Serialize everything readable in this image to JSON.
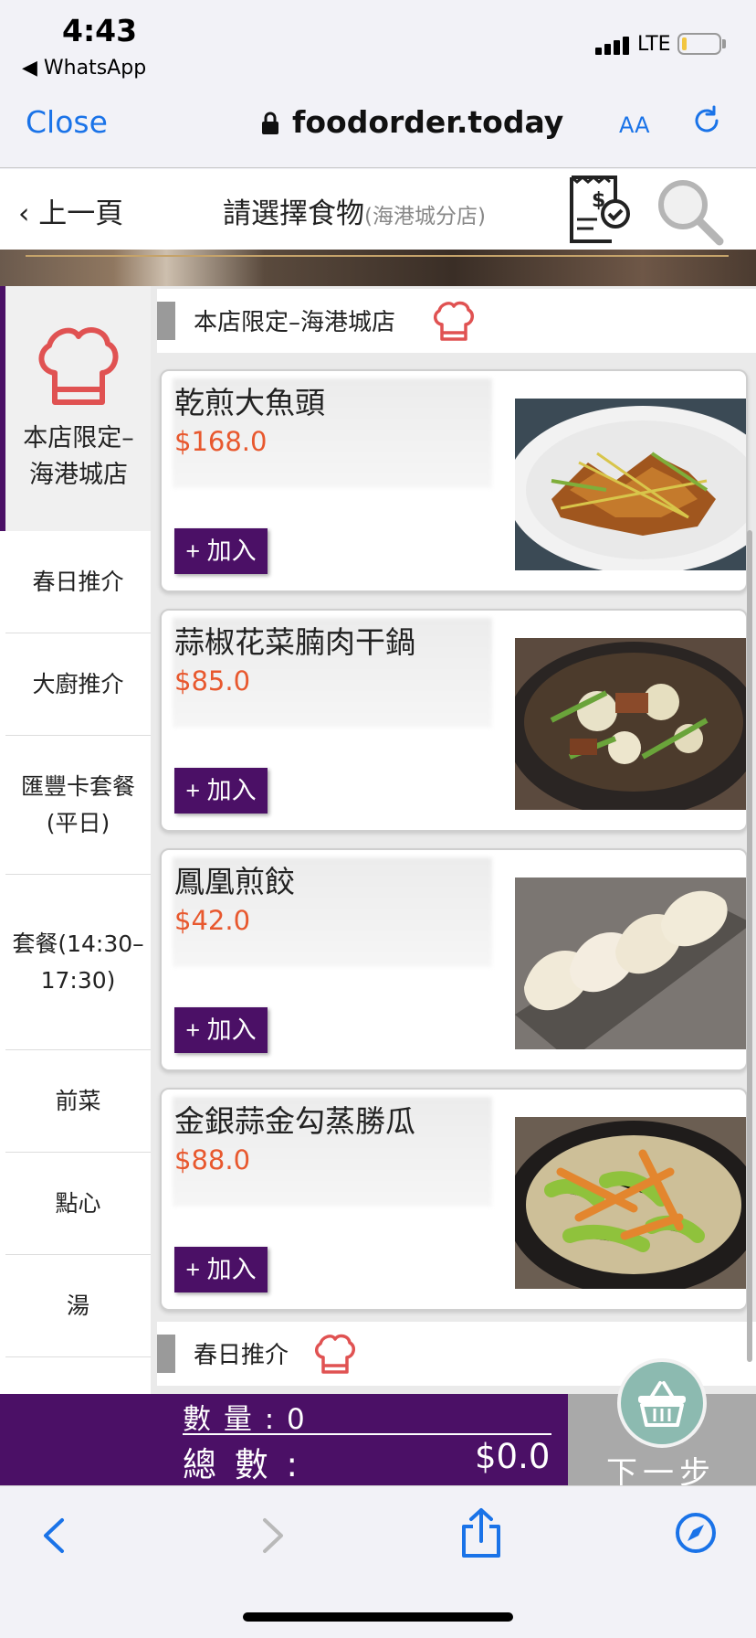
{
  "status": {
    "time": "4:43",
    "back_app": "◀ WhatsApp",
    "network": "LTE"
  },
  "browser": {
    "close": "Close",
    "url": "foodorder.today",
    "text_size": "AA"
  },
  "nav": {
    "back": "上一頁",
    "title": "請選擇食物",
    "branch": "(海港城分店)"
  },
  "colors": {
    "accent": "#4b1066",
    "price": "#e8582e",
    "link": "#1a73e8",
    "hat": "#e05252",
    "basket": "#8cbab0"
  },
  "sidebar": {
    "active": "本店限定–海港城店",
    "items": [
      {
        "label": "春日推介"
      },
      {
        "label": "大廚推介"
      },
      {
        "label": "匯豐卡套餐(平日)"
      },
      {
        "label": "套餐(14:30–17:30)"
      },
      {
        "label": "前菜"
      },
      {
        "label": "點心"
      },
      {
        "label": "湯"
      }
    ]
  },
  "sections": [
    {
      "label": "本店限定–海港城店"
    },
    {
      "label": "春日推介"
    }
  ],
  "items": [
    {
      "name": "乾煎大魚頭",
      "price": "$168.0",
      "add": "+ 加入"
    },
    {
      "name": "蒜椒花菜腩肉干鍋",
      "price": "$85.0",
      "add": "+ 加入"
    },
    {
      "name": "鳳凰煎餃",
      "price": "$42.0",
      "add": "+ 加入"
    },
    {
      "name": "金銀蒜金勾蒸勝瓜",
      "price": "$88.0",
      "add": "+ 加入"
    }
  ],
  "cart": {
    "qty_label": "數 量 :",
    "qty": "0",
    "total_label": "總 數 :",
    "total": "$0.0",
    "next": "下一步"
  },
  "icons": [
    "lock-icon",
    "reload-icon",
    "receipt-icon",
    "search-icon",
    "chef-hat-icon",
    "basket-icon",
    "back-arrow-icon",
    "forward-arrow-icon",
    "share-icon",
    "compass-icon"
  ]
}
